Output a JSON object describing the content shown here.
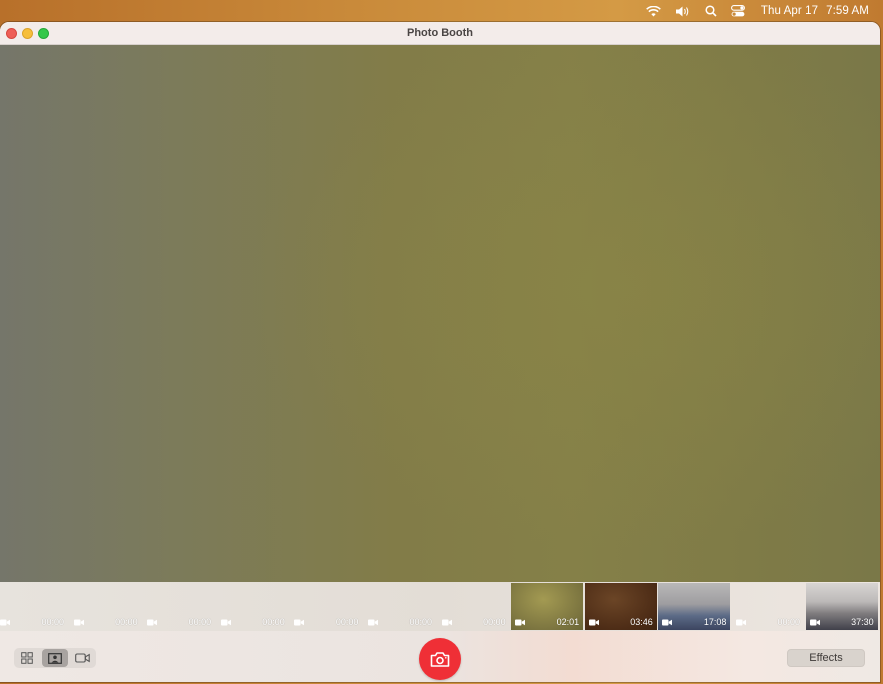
{
  "menubar": {
    "icons": [
      "wifi-icon",
      "volume-icon",
      "search-icon",
      "control-center-icon"
    ],
    "date": "Thu Apr 17",
    "time": "7:59 AM"
  },
  "window": {
    "title": "Photo Booth"
  },
  "strip": {
    "items": [
      {
        "kind": "empty",
        "duration": "00:00"
      },
      {
        "kind": "empty",
        "duration": "00:00"
      },
      {
        "kind": "empty",
        "duration": "00:00"
      },
      {
        "kind": "empty",
        "duration": "00:00"
      },
      {
        "kind": "empty",
        "duration": "00:00"
      },
      {
        "kind": "empty",
        "duration": "00:00"
      },
      {
        "kind": "empty",
        "duration": "00:00"
      },
      {
        "kind": "video",
        "duration": "02:01"
      },
      {
        "kind": "video",
        "duration": "03:46"
      },
      {
        "kind": "video",
        "duration": "17:08"
      },
      {
        "kind": "empty",
        "duration": "00:00"
      },
      {
        "kind": "video",
        "duration": "37:30"
      }
    ]
  },
  "toolbar": {
    "view_modes": [
      "grid-view",
      "photo-view",
      "video-view"
    ],
    "active_mode": "photo-view",
    "effects_label": "Effects"
  },
  "colors": {
    "shutter": "#ef2f36",
    "close": "#ee5e57",
    "minimize": "#f6be3b",
    "maximize": "#34c84a"
  }
}
